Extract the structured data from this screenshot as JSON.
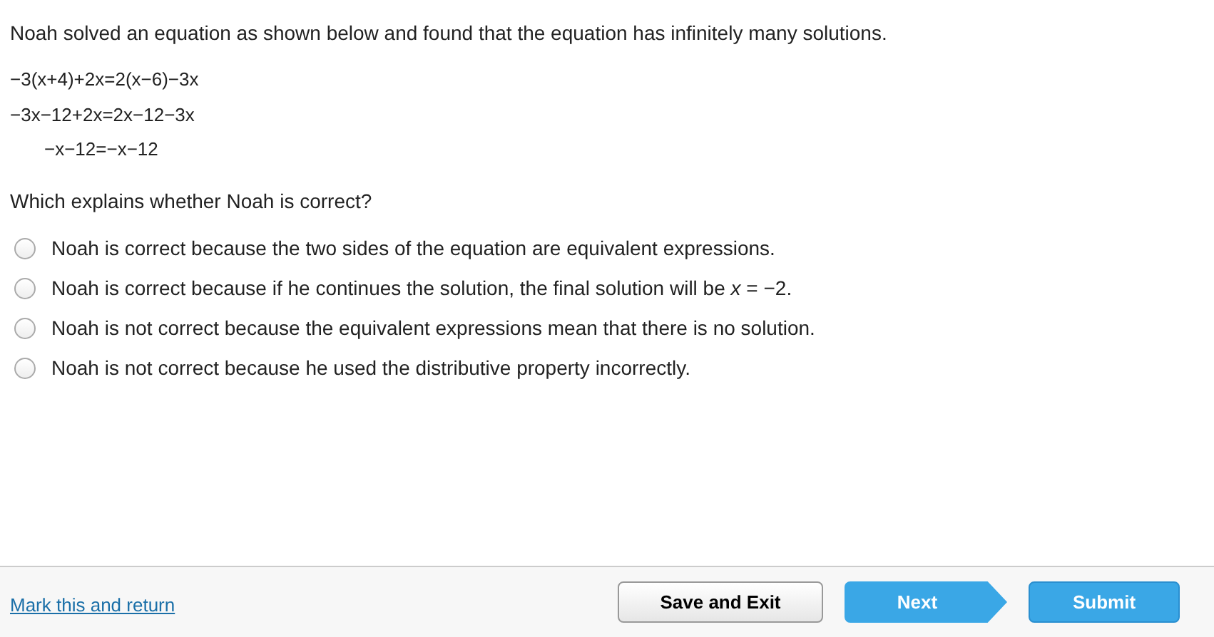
{
  "question": {
    "prompt": "Noah solved an equation as shown below and found that the equation has infinitely many solutions.",
    "steps": [
      {
        "text": "−3(x+4)+2x=2(x−6)−3x"
      },
      {
        "text": "−3x−12+2x=2x−12−3x"
      },
      {
        "text": "−x−12=−x−12"
      }
    ],
    "ask": "Which explains whether Noah is correct?"
  },
  "options": [
    {
      "text": "Noah is correct because the two sides of the equation are equivalent expressions.",
      "selected": false
    },
    {
      "text": "Noah is correct because if he continues the solution, the final solution will be *x* = −2.",
      "selected": false
    },
    {
      "text": "Noah is not correct because the equivalent expressions mean that there is no solution.",
      "selected": false
    },
    {
      "text": "Noah is not correct because he used the distributive property incorrectly.",
      "selected": false
    }
  ],
  "footer": {
    "link": "Mark this and return",
    "buttons": [
      {
        "kind": "secondary",
        "label": "Save and Exit"
      },
      {
        "kind": "next",
        "label": "Next"
      },
      {
        "kind": "primary",
        "label": "Submit"
      }
    ]
  }
}
